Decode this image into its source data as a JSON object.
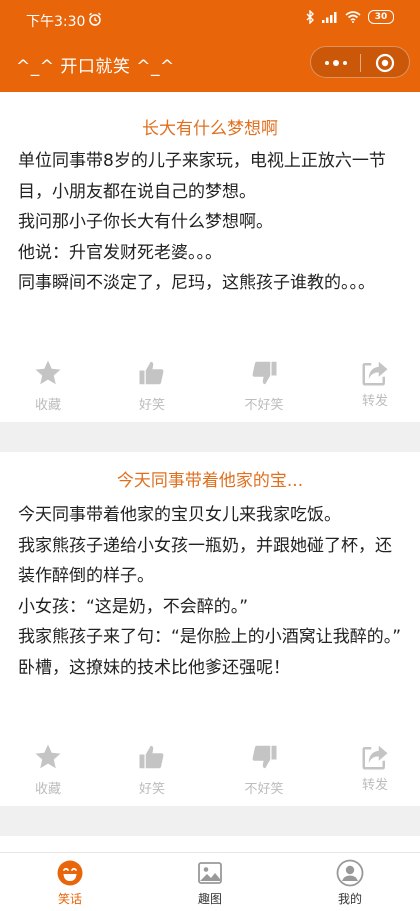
{
  "status_bar": {
    "time": "下午3:30",
    "battery": "30"
  },
  "header": {
    "title": "^_^ 开口就笑 ^_^"
  },
  "posts": [
    {
      "title": "长大有什么梦想啊",
      "paragraphs": [
        "单位同事带8岁的儿子来家玩，电视上正放六一节目，小朋友都在说自己的梦想。",
        "我问那小子你长大有什么梦想啊。",
        "他说：升官发财死老婆。。。",
        "同事瞬间不淡定了，尼玛，这熊孩子谁教的。。。"
      ]
    },
    {
      "title": "今天同事带着他家的宝...",
      "paragraphs": [
        "今天同事带着他家的宝贝女儿来我家吃饭。",
        "我家熊孩子递给小女孩一瓶奶，并跟她碰了杯，还装作醉倒的样子。",
        "小女孩：“这是奶，不会醉的。”",
        "我家熊孩子来了句：“是你脸上的小酒窝让我醉的。”",
        "卧槽，这撩妹的技术比他爹还强呢！"
      ]
    }
  ],
  "actions": {
    "favorite": "收藏",
    "like": "好笑",
    "dislike": "不好笑",
    "share": "转发"
  },
  "tabs": [
    {
      "label": "笑话",
      "icon": "smile-icon",
      "active": true
    },
    {
      "label": "趣图",
      "icon": "image-icon",
      "active": false
    },
    {
      "label": "我的",
      "icon": "user-icon",
      "active": false
    }
  ],
  "colors": {
    "brand": "#e8650a",
    "title_orange": "#e07020",
    "action_gray": "#c4c4c4"
  }
}
